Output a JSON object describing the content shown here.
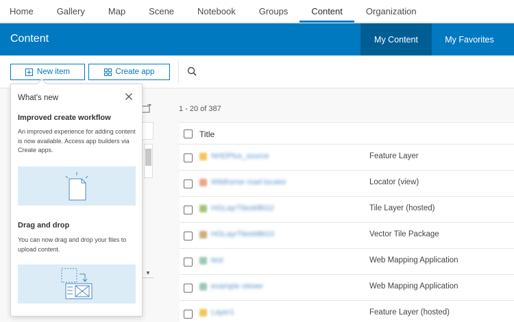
{
  "topnav": {
    "items": [
      {
        "label": "Home"
      },
      {
        "label": "Gallery"
      },
      {
        "label": "Map"
      },
      {
        "label": "Scene"
      },
      {
        "label": "Notebook"
      },
      {
        "label": "Groups"
      },
      {
        "label": "Content",
        "active": true
      },
      {
        "label": "Organization"
      }
    ]
  },
  "header": {
    "title": "Content",
    "tabs": [
      {
        "label": "My Content",
        "active": true
      },
      {
        "label": "My Favorites"
      }
    ]
  },
  "toolbar": {
    "new_item_label": "New item",
    "create_app_label": "Create app"
  },
  "results": {
    "count_text": "1 - 20 of 387",
    "title_header": "Title",
    "rows": [
      {
        "name": "NHDPlus_source",
        "type": "Feature Layer",
        "thumb_color": "#f2c45a"
      },
      {
        "name": "Wildhorse road locator",
        "type": "Locator (view)",
        "thumb_color": "#e8a48c"
      },
      {
        "name": "HGLayrTilesMBG2",
        "type": "Tile Layer (hosted)",
        "thumb_color": "#a7c27a"
      },
      {
        "name": "HGLayrTilesMBG3",
        "type": "Vector Tile Package",
        "thumb_color": "#c9b07a"
      },
      {
        "name": "test",
        "type": "Web Mapping Application",
        "thumb_color": "#9fc7b4"
      },
      {
        "name": "example viewer",
        "type": "Web Mapping Application",
        "thumb_color": "#9fc7b4"
      },
      {
        "name": "Layer1",
        "type": "Feature Layer (hosted)",
        "thumb_color": "#f2c45a"
      }
    ]
  },
  "popover": {
    "title": "What's new",
    "section1_heading": "Improved create workflow",
    "section1_text": "An improved experience for adding content is now available. Access app builders via Create apps.",
    "section2_heading": "Drag and drop",
    "section2_text": "You can now drag and drop your files to upload content."
  },
  "colors": {
    "brand_blue": "#0079c1",
    "header_active_tab": "#005e95",
    "illustration_bg": "#dcecf6"
  }
}
